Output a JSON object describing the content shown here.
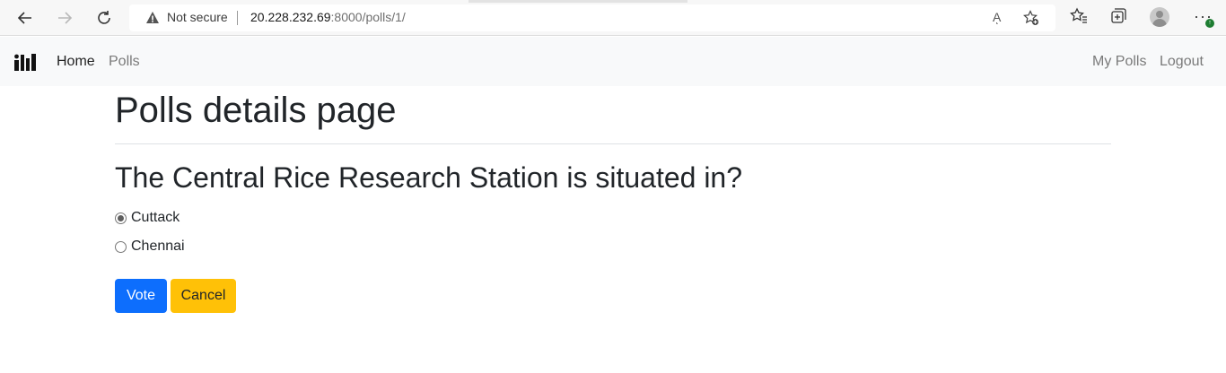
{
  "browser": {
    "security_label": "Not secure",
    "url_host": "20.228.232.69",
    "url_rest": ":8000/polls/1/",
    "read_aloud_glyph": "Aͅ",
    "update_badge": "↑",
    "icons": [
      "back-arrow-icon",
      "forward-arrow-icon",
      "refresh-icon",
      "warning-icon",
      "read-aloud-icon",
      "add-favorite-icon",
      "favorites-icon",
      "collections-icon",
      "profile-icon",
      "more-icon"
    ]
  },
  "navbar": {
    "home_label": "Home",
    "polls_label": "Polls",
    "my_polls_label": "My Polls",
    "logout_label": "Logout"
  },
  "page": {
    "title": "Polls details page",
    "question": "The Central Rice Research Station is situated in?",
    "choices": [
      {
        "label": "Cuttack",
        "checked": true
      },
      {
        "label": "Chennai",
        "checked": false
      }
    ],
    "vote_label": "Vote",
    "cancel_label": "Cancel"
  },
  "colors": {
    "primary": "#0d6efd",
    "warning": "#ffc107",
    "navbar_bg": "#f8f9fa"
  }
}
